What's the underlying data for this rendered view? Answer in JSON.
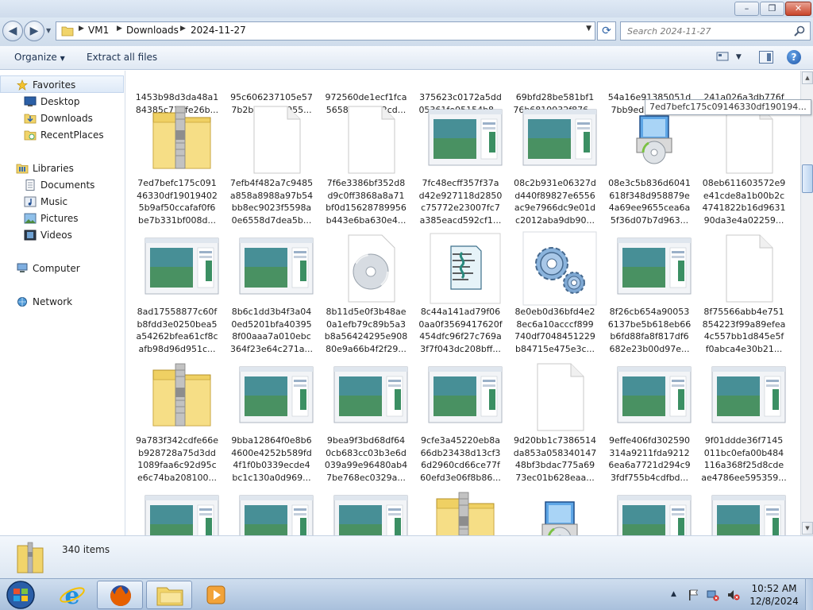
{
  "window": {
    "min_label": "–",
    "max_label": "❐",
    "close_label": "✕"
  },
  "address": {
    "crumbs": [
      "VM1",
      "Downloads",
      "2024-11-27"
    ],
    "search_placeholder": "Search 2024-11-27"
  },
  "toolbar": {
    "organize": "Organize",
    "extract": "Extract all files"
  },
  "nav": {
    "favorites": "Favorites",
    "desktop": "Desktop",
    "downloads": "Downloads",
    "recent": "RecentPlaces",
    "libraries": "Libraries",
    "documents": "Documents",
    "music": "Music",
    "pictures": "Pictures",
    "videos": "Videos",
    "computer": "Computer",
    "network": "Network"
  },
  "rows": [
    {
      "items": [
        {
          "type": "none",
          "lines": [
            "1453b98d3da48a1",
            "84385c774fe26b..."
          ]
        },
        {
          "type": "none",
          "lines": [
            "95c606237105e57",
            "7b2bb9a359955..."
          ]
        },
        {
          "type": "none",
          "lines": [
            "972560de1ecf1fca",
            "56580739772cd..."
          ]
        },
        {
          "type": "none",
          "lines": [
            "375623c0172a5dd",
            "05361fe95154b8..."
          ]
        },
        {
          "type": "none",
          "lines": [
            "69bfd28be581bf1",
            "76b6819932f876..."
          ]
        },
        {
          "type": "none",
          "lines": [
            "54a16e91385051d",
            "7bb9ed183a63f..."
          ]
        },
        {
          "type": "none",
          "lines": [
            "241a026a3db776f",
            "9eca1f082e4894..."
          ]
        }
      ]
    },
    {
      "items": [
        {
          "type": "zip",
          "lines": [
            "7ed7befc175c091",
            "46330df19019402",
            "5b9af50ccafaf0f6",
            "be7b331bf008d..."
          ]
        },
        {
          "type": "blank",
          "lines": [
            "7efb4f482a7c9485",
            "a858a8988a97b54",
            "bb8ec9023f5598a",
            "0e6558d7dea5b..."
          ]
        },
        {
          "type": "blank",
          "lines": [
            "7f6e3386bf352d8",
            "d9c0ff3868a8a71",
            "bf0d15628789956",
            "b443e6ba630e4..."
          ]
        },
        {
          "type": "window",
          "lines": [
            "7fc48ecff357f37a",
            "d42e927118d2850",
            "c75772e23007fc7",
            "a385eacd592cf1..."
          ]
        },
        {
          "type": "window",
          "lines": [
            "08c2b931e06327d",
            "d440f89827e6556",
            "ac9e7966dc9e01d",
            "c2012aba9db90..."
          ]
        },
        {
          "type": "installer",
          "lines": [
            "08e3c5b836d6041",
            "618f348d958879e",
            "4a69ee9655cea6a",
            "5f36d07b7d963..."
          ]
        },
        {
          "type": "blank",
          "lines": [
            "08eb611603572e9",
            "e41cde8a1b00b2c",
            "4741822b16d9631",
            "90da3e4a02259..."
          ]
        }
      ]
    },
    {
      "items": [
        {
          "type": "window",
          "lines": [
            "8ad17558877c60f",
            "b8fdd3e0250bea5",
            "a54262bfea61cf8c",
            "afb98d96d951c..."
          ]
        },
        {
          "type": "window",
          "lines": [
            "8b6c1dd3b4f3a04",
            "0ed5201bfa40395",
            "8f00aaa7a010ebc",
            "364f23e64c271a..."
          ]
        },
        {
          "type": "disc",
          "lines": [
            "8b11d5e0f3b48ae",
            "0a1efb79c89b5a3",
            "b8a56424295e908",
            "80e9a66b4f2f29..."
          ]
        },
        {
          "type": "script",
          "lines": [
            "8c44a141ad79f06",
            "0aa0f3569417620f",
            "454dfc96f27c769a",
            "3f7f043dc208bff..."
          ]
        },
        {
          "type": "gears",
          "lines": [
            "8e0eb0d36bfd4e2",
            "8ec6a10acccf899",
            "740df7048451229",
            "b84715e475e3c..."
          ]
        },
        {
          "type": "window",
          "lines": [
            "8f26cb654a90053",
            "6137be5b618eb66",
            "b6fd88fa8f817df6",
            "682e23b00d97e..."
          ]
        },
        {
          "type": "blank",
          "lines": [
            "8f75566abb4e751",
            "854223f99a89efea",
            "4c557bb1d845e5f",
            "f0abca4e30b21..."
          ]
        }
      ]
    },
    {
      "items": [
        {
          "type": "zip",
          "lines": [
            "9a783f342cdfe66e",
            "b928728a75d3dd",
            "1089faa6c92d95c",
            "e6c74ba208100..."
          ]
        },
        {
          "type": "window",
          "lines": [
            "9bba12864f0e8b6",
            "4600e4252b589fd",
            "4f1f0b0339ecde4",
            "bc1c130a0d969..."
          ]
        },
        {
          "type": "window",
          "lines": [
            "9bea9f3bd68df64",
            "0cb683cc03b3e6d",
            "039a99e96480ab4",
            "7be768ec0329a..."
          ]
        },
        {
          "type": "window",
          "lines": [
            "9cfe3a45220eb8a",
            "66db23438d13cf3",
            "6d2960cd66ce77f",
            "60efd3e06f8b86..."
          ]
        },
        {
          "type": "blank",
          "lines": [
            "9d20bb1c7386514",
            "da853a058340147",
            "48bf3bdac775a69",
            "73ec01b628eaa..."
          ]
        },
        {
          "type": "window",
          "lines": [
            "9effe406fd302590",
            "314a9211fda9212",
            "6ea6a7721d294c9",
            "3fdf755b4cdfbd..."
          ]
        },
        {
          "type": "window",
          "lines": [
            "9f01ddde36f7145",
            "011bc0efa00b484",
            "116a368f25d8cde",
            "ae4786ee595359..."
          ]
        }
      ]
    },
    {
      "items": [
        {
          "type": "window",
          "lines": []
        },
        {
          "type": "window",
          "lines": []
        },
        {
          "type": "window",
          "lines": []
        },
        {
          "type": "zip",
          "lines": []
        },
        {
          "type": "installer",
          "lines": []
        },
        {
          "type": "window",
          "lines": []
        },
        {
          "type": "window",
          "lines": []
        }
      ]
    }
  ],
  "tooltip": "7ed7befc175c09146330df190194...",
  "status": {
    "count": "340 items"
  },
  "taskbar": {
    "time": "10:52 AM",
    "date": "12/8/2024"
  },
  "colors": {
    "accent": "#2c62a6",
    "folder_yellow": "#f1d46a",
    "window_teal": "#2f7d6e"
  }
}
